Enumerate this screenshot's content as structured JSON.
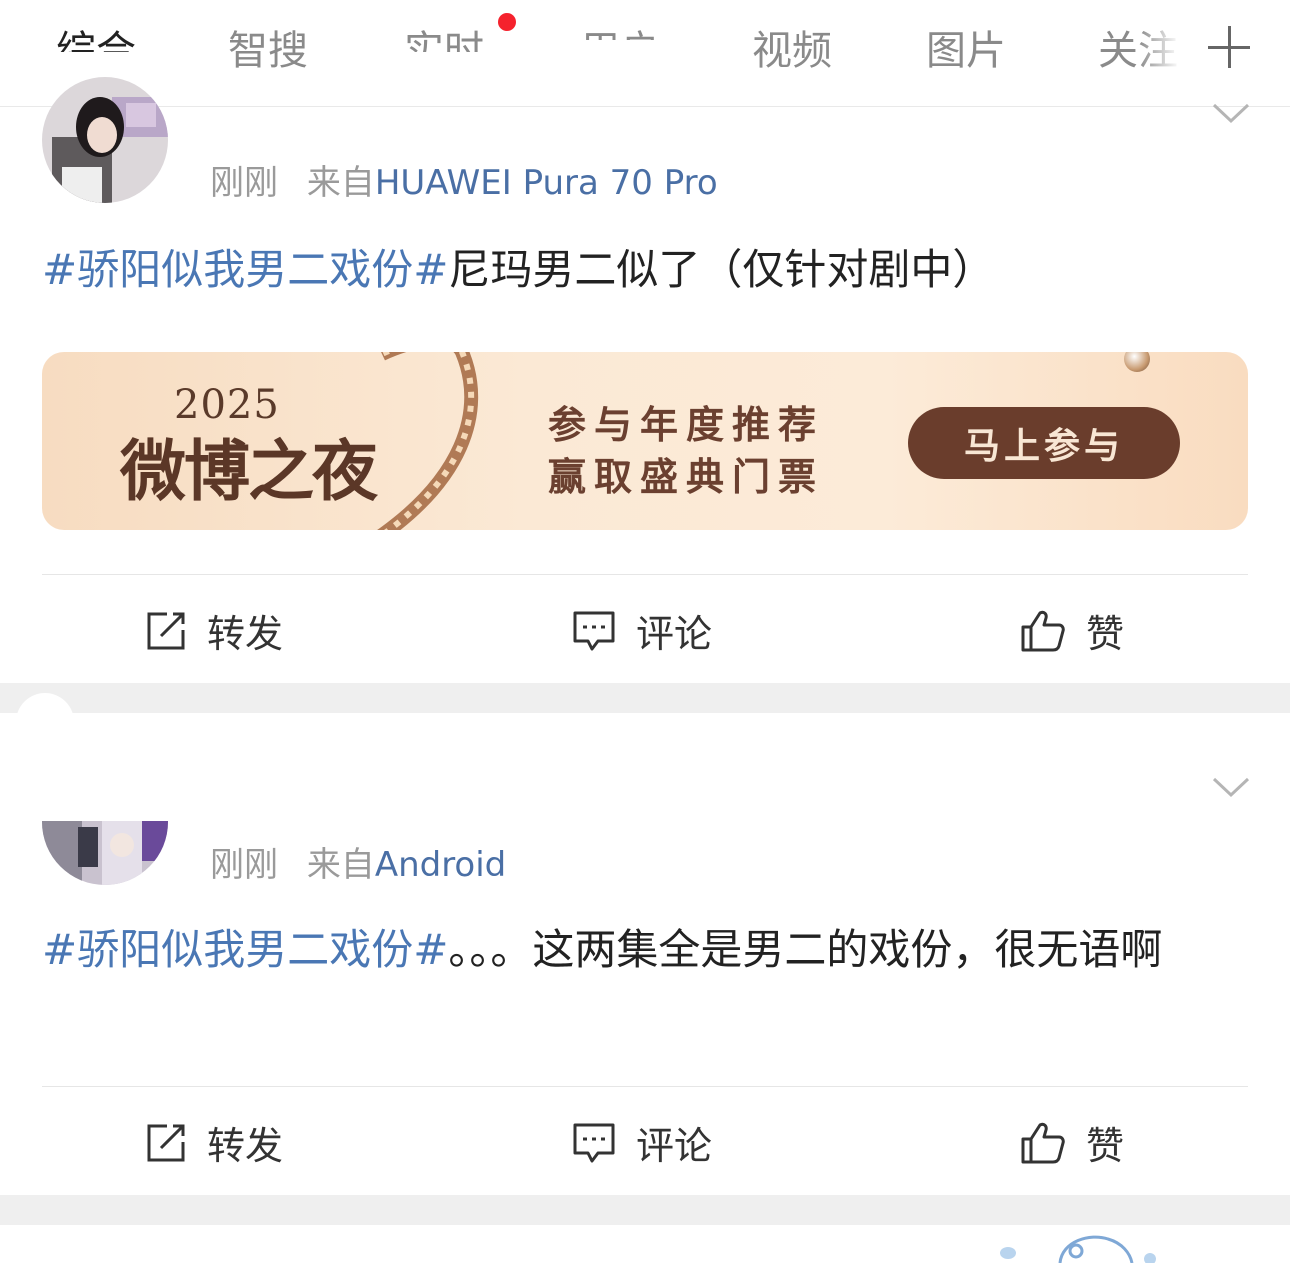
{
  "tabs": [
    {
      "label": "综合",
      "active": true
    },
    {
      "label": "智搜",
      "active": false
    },
    {
      "label": "实时",
      "active": false,
      "has_dot": true
    },
    {
      "label": "用户",
      "active": false
    },
    {
      "label": "视频",
      "active": false
    },
    {
      "label": "图片",
      "active": false
    },
    {
      "label": "关注",
      "active": false
    }
  ],
  "add_tab_icon": "plus-icon",
  "posts": [
    {
      "time": "刚刚",
      "from_prefix": "来自",
      "source": "HUAWEI Pura 70 Pro",
      "topic": "#骄阳似我男二戏份#",
      "text": "尼玛男二似了（仅针对剧中）",
      "banner": {
        "year": "2025",
        "title": "微博之夜",
        "line1": "参与年度推荐",
        "line2": "赢取盛典门票",
        "button": "马上参与"
      },
      "actions": {
        "repost": "转发",
        "comment": "评论",
        "like": "赞"
      }
    },
    {
      "time": "刚刚",
      "from_prefix": "来自",
      "source": "Android",
      "topic": "#骄阳似我男二戏份#",
      "text": "。。。这两集全是男二的戏份，很无语啊",
      "actions": {
        "repost": "转发",
        "comment": "评论",
        "like": "赞"
      }
    }
  ],
  "colors": {
    "topic": "#4a77b4",
    "source": "#4a6fa5",
    "dot": "#f5222d",
    "banner_button": "#6a3d2c"
  }
}
